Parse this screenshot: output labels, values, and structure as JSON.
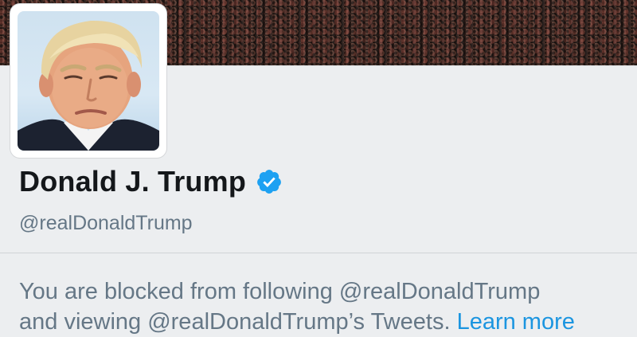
{
  "profile": {
    "display_name": "Donald J. Trump",
    "handle": "@realDonaldTrump",
    "verified": true,
    "avatar_icon": "profile-photo",
    "banner": "crowd-photo-banner"
  },
  "notice": {
    "line1": "You are blocked from following @realDonaldTrump",
    "line2": "and viewing @realDonaldTrump’s Tweets.",
    "link_label": "Learn more"
  },
  "colors": {
    "name": "#14171a",
    "secondary_text": "#657786",
    "link": "#1b95e0",
    "verified_badge": "#1da1f2",
    "background": "#eceef0"
  }
}
